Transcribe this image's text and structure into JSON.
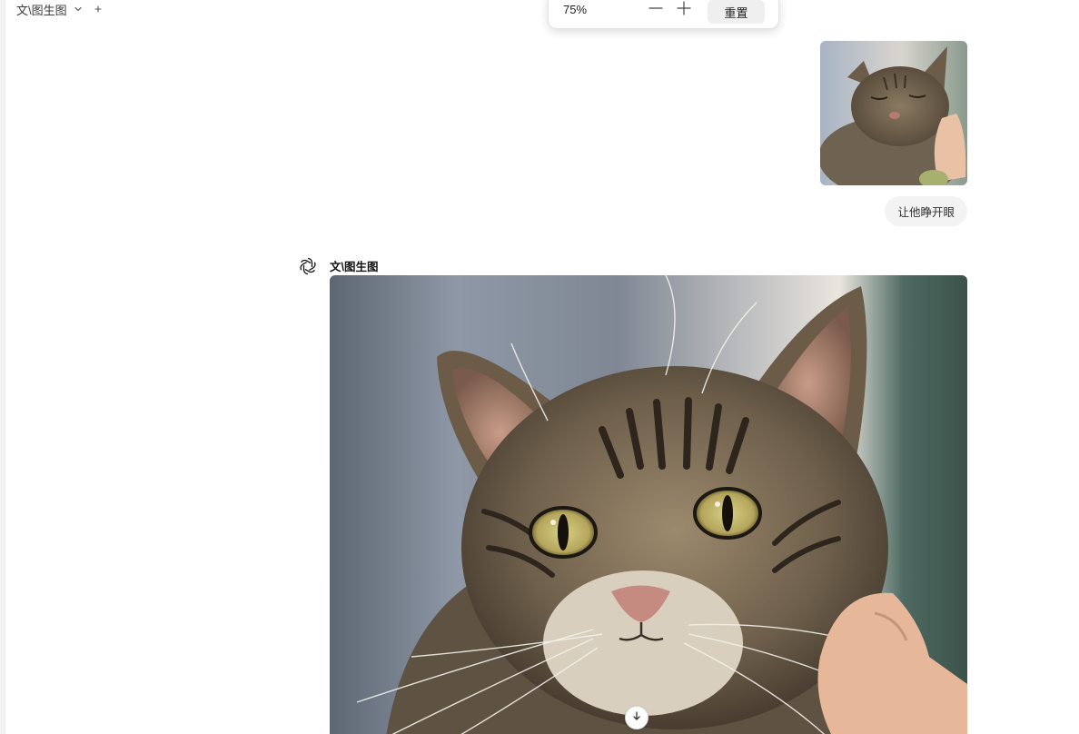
{
  "header": {
    "model_name": "文\\图生图",
    "dropdown_icon": "chevron-down-icon",
    "new_icon": "plus-icon"
  },
  "zoom": {
    "level": "75%",
    "reset_label": "重置",
    "minus_icon": "minus-icon",
    "plus_icon": "plus-icon"
  },
  "user_message": {
    "image_alt": "sleeping tabby cat being petted",
    "text": "让他睁开眼"
  },
  "assistant": {
    "name": "文\\图生图",
    "avatar_icon": "openai-logo-icon",
    "image_alt": "tabby cat with eyes open"
  },
  "scroll_button_icon": "arrow-down-icon",
  "colors": {
    "bubble_bg": "#f3f3f3",
    "reset_bg": "#efefef",
    "text": "#1f1f1f"
  }
}
